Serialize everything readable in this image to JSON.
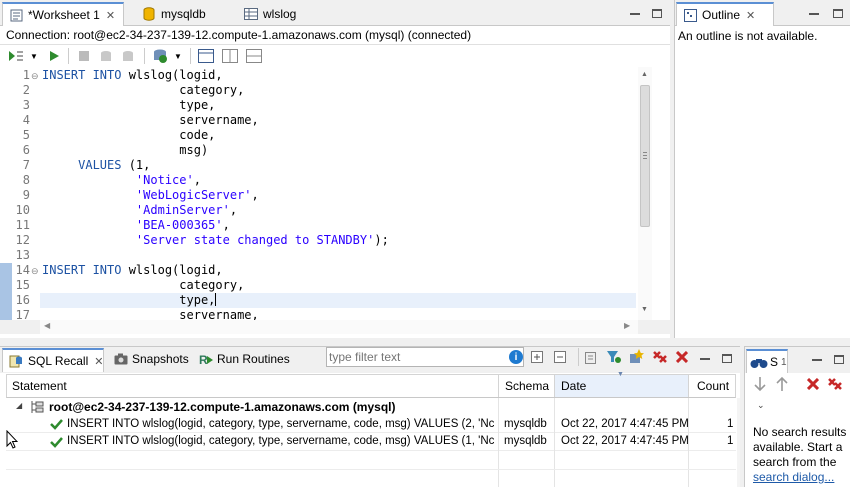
{
  "editor_tabs": [
    {
      "label": "*Worksheet 1",
      "icon": "worksheet-icon"
    },
    {
      "label": "mysqldb",
      "icon": "database-icon"
    },
    {
      "label": "wlslog",
      "icon": "table-icon"
    }
  ],
  "connection": "Connection: root@ec2-34-237-139-12.compute-1.amazonaws.com (mysql) (connected)",
  "outline": {
    "tab_label": "Outline",
    "message": "An outline is not available."
  },
  "code_lines": [
    {
      "n": "1",
      "t": [
        [
          "kw",
          "INSERT INTO "
        ],
        [
          "pl",
          "wlslog(logid,"
        ]
      ]
    },
    {
      "n": "2",
      "t": [
        [
          "pl",
          "                   category,"
        ]
      ]
    },
    {
      "n": "3",
      "t": [
        [
          "pl",
          "                   type,"
        ]
      ]
    },
    {
      "n": "4",
      "t": [
        [
          "pl",
          "                   servername,"
        ]
      ]
    },
    {
      "n": "5",
      "t": [
        [
          "pl",
          "                   code,"
        ]
      ]
    },
    {
      "n": "6",
      "t": [
        [
          "pl",
          "                   msg)"
        ]
      ]
    },
    {
      "n": "7",
      "t": [
        [
          "kw",
          "     VALUES "
        ],
        [
          "pl",
          "(1,"
        ]
      ]
    },
    {
      "n": "8",
      "t": [
        [
          "pl",
          "             "
        ],
        [
          "str",
          "'Notice'"
        ],
        [
          "pl",
          ","
        ]
      ]
    },
    {
      "n": "9",
      "t": [
        [
          "pl",
          "             "
        ],
        [
          "str",
          "'WebLogicServer'"
        ],
        [
          "pl",
          ","
        ]
      ]
    },
    {
      "n": "10",
      "t": [
        [
          "pl",
          "             "
        ],
        [
          "str",
          "'AdminServer'"
        ],
        [
          "pl",
          ","
        ]
      ]
    },
    {
      "n": "11",
      "t": [
        [
          "pl",
          "             "
        ],
        [
          "str",
          "'BEA-000365'"
        ],
        [
          "pl",
          ","
        ]
      ]
    },
    {
      "n": "12",
      "t": [
        [
          "pl",
          "             "
        ],
        [
          "str",
          "'Server state changed to STANDBY'"
        ],
        [
          "pl",
          ");"
        ]
      ]
    },
    {
      "n": "13",
      "t": []
    },
    {
      "n": "14",
      "t": [
        [
          "kw",
          "INSERT INTO "
        ],
        [
          "pl",
          "wlslog(logid,"
        ]
      ]
    },
    {
      "n": "15",
      "t": [
        [
          "pl",
          "                   category,"
        ]
      ]
    },
    {
      "n": "16",
      "t": [
        [
          "pl",
          "                   type,"
        ]
      ]
    },
    {
      "n": "17",
      "t": [
        [
          "pl",
          "                   servername,"
        ]
      ]
    }
  ],
  "bottom_tabs": [
    {
      "label": "SQL Recall",
      "icon": "sql-recall-icon"
    },
    {
      "label": "Snapshots",
      "icon": "camera-icon"
    },
    {
      "label": "Run Routines",
      "icon": "routine-icon"
    }
  ],
  "filter": {
    "placeholder": "type filter text"
  },
  "columns": [
    "Statement",
    "Schema",
    "Date",
    "Count"
  ],
  "tree_root": "root@ec2-34-237-139-12.compute-1.amazonaws.com (mysql)",
  "rows": [
    {
      "statement": "INSERT INTO wlslog(logid, category, type, servername, code, msg) VALUES (2, 'Nc",
      "schema": "mysqldb",
      "date": "Oct 22, 2017 4:47:45 PM",
      "count": "1"
    },
    {
      "statement": "INSERT INTO wlslog(logid, category, type, servername, code, msg) VALUES (1, 'Nc",
      "schema": "mysqldb",
      "date": "Oct 22, 2017 4:47:45 PM",
      "count": "1"
    }
  ],
  "search_panel": {
    "tab_label": "S",
    "tab_suffix": "1",
    "message": "No search results available. Start a search from the",
    "link": "search dialog..."
  },
  "colors": {
    "accent": "#5b8fd4",
    "keyword": "#1d52a3",
    "string": "#2a00ff",
    "check": "#2e8b2e",
    "delete": "#c62828"
  }
}
